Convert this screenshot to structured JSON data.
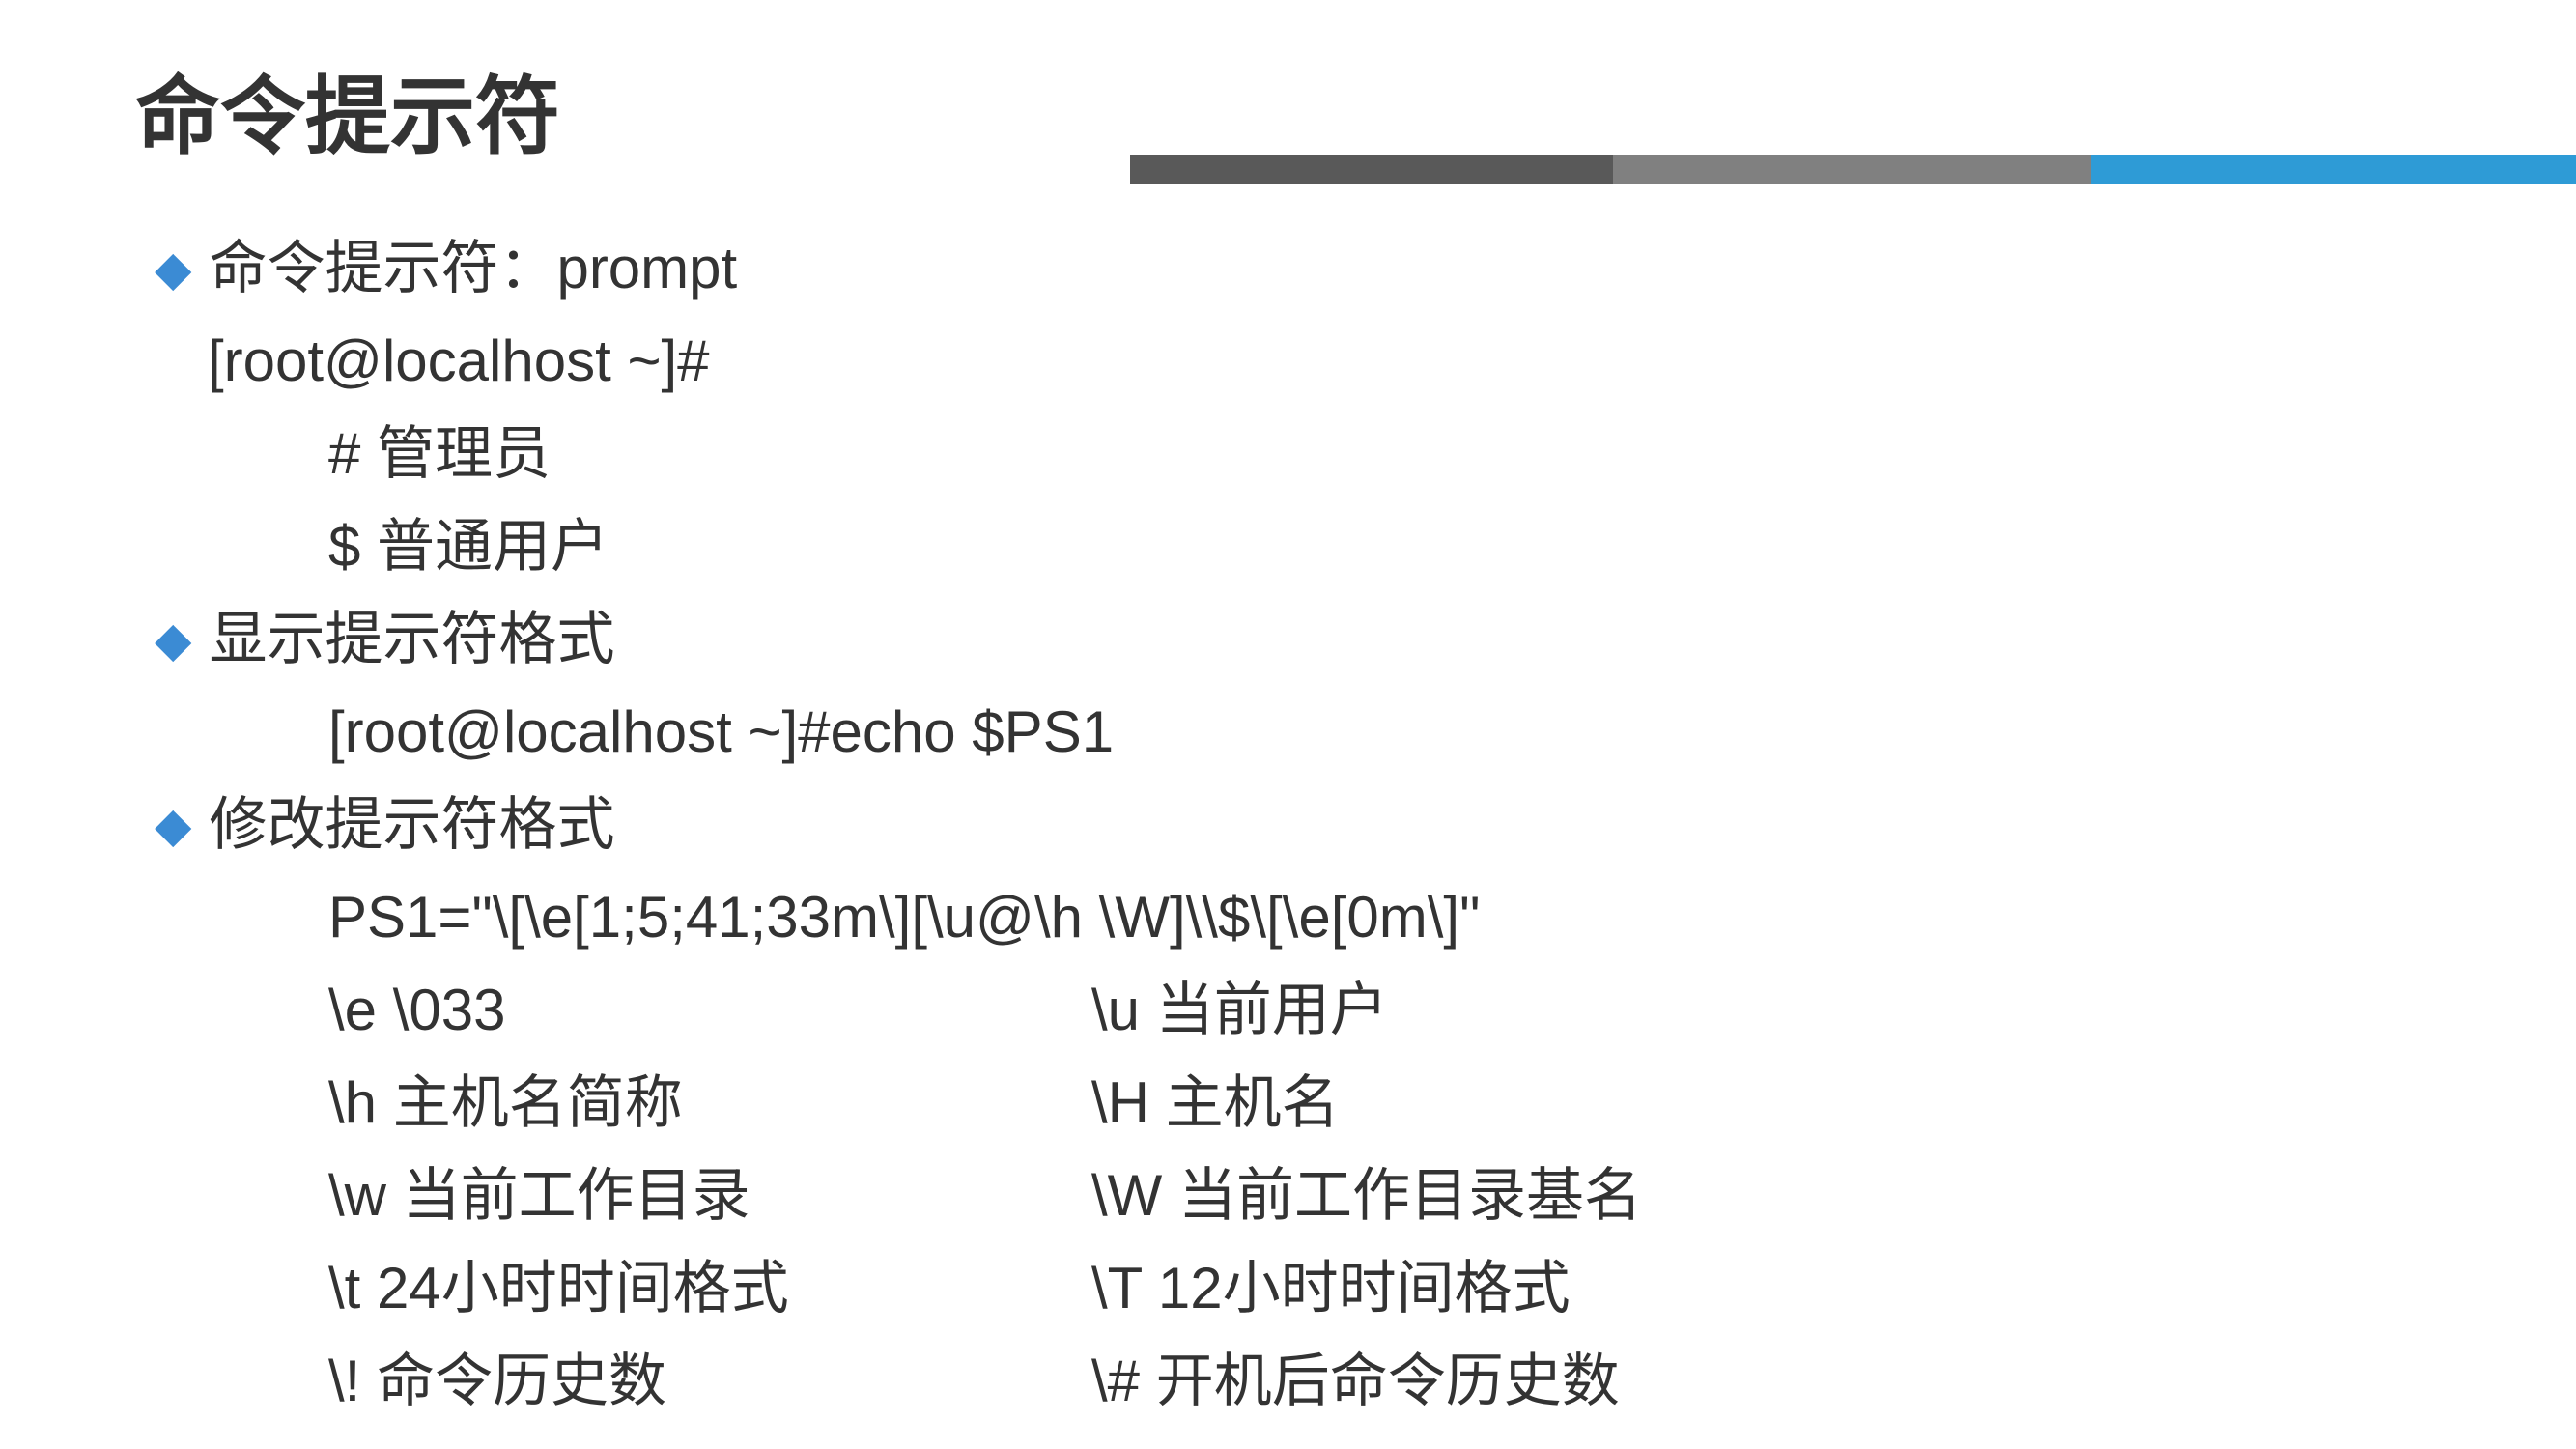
{
  "title": "命令提示符",
  "sections": {
    "s1": {
      "heading": "命令提示符：prompt",
      "line1": "[root@localhost ~]#",
      "line2": "# 管理员",
      "line3": "$ 普通用户"
    },
    "s2": {
      "heading": "显示提示符格式",
      "line1": "[root@localhost ~]#echo $PS1"
    },
    "s3": {
      "heading": "修改提示符格式",
      "line1": "PS1=\"\\[\\e[1;5;41;33m\\][\\u@\\h \\W]\\\\$\\[\\e[0m\\]\"",
      "row1": {
        "left": "\\e \\033",
        "right": "\\u 当前用户"
      },
      "row2": {
        "left": "\\h 主机名简称",
        "right": "\\H 主机名"
      },
      "row3": {
        "left": "\\w 当前工作目录",
        "right": "\\W 当前工作目录基名"
      },
      "row4": {
        "left": "\\t  24小时时间格式",
        "right": "\\T  12小时时间格式"
      },
      "row5": {
        "left": "\\! 命令历史数",
        "right": " \\# 开机后命令历史数"
      }
    }
  }
}
